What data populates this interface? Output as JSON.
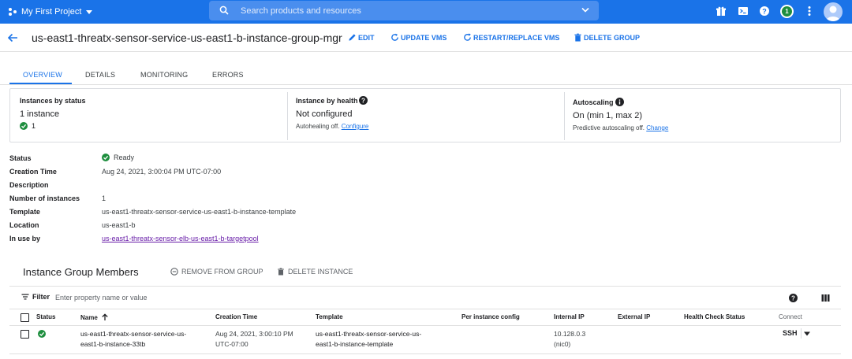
{
  "topbar": {
    "project": "My First Project",
    "search_placeholder": "Search products and resources",
    "notification_count": "1"
  },
  "header": {
    "title": "us-east1-threatx-sensor-service-us-east1-b-instance-group-mgr",
    "actions": {
      "edit": "EDIT",
      "update": "UPDATE VMS",
      "restart": "RESTART/REPLACE VMS",
      "delete": "DELETE GROUP"
    }
  },
  "tabs": [
    "OVERVIEW",
    "DETAILS",
    "MONITORING",
    "ERRORS"
  ],
  "summary": {
    "status": {
      "title": "Instances by status",
      "value": "1 instance",
      "ok_count": "1"
    },
    "health": {
      "title": "Instance by health",
      "value": "Not configured",
      "sub": "Autohealing off.",
      "link": "Configure"
    },
    "autoscaling": {
      "title": "Autoscaling",
      "value": "On (min 1, max 2)",
      "sub": "Predictive autoscaling off.",
      "link": "Change"
    }
  },
  "details": {
    "status_label": "Status",
    "status_value": "Ready",
    "creation_label": "Creation Time",
    "creation_value": "Aug 24, 2021, 3:00:04 PM UTC-07:00",
    "description_label": "Description",
    "instances_label": "Number of instances",
    "instances_value": "1",
    "template_label": "Template",
    "template_value": "us-east1-threatx-sensor-service-us-east1-b-instance-template",
    "location_label": "Location",
    "location_value": "us-east1-b",
    "inuse_label": "In use by",
    "inuse_value": "us-east1-threatx-sensor-elb-us-east1-b-targetpool"
  },
  "members": {
    "title": "Instance Group Members",
    "remove": "REMOVE FROM GROUP",
    "delete": "DELETE INSTANCE",
    "filter_label": "Filter",
    "filter_placeholder": "Enter property name or value",
    "columns": {
      "status": "Status",
      "name": "Name",
      "creation": "Creation Time",
      "template": "Template",
      "per_instance": "Per instance config",
      "internal_ip": "Internal IP",
      "external_ip": "External IP",
      "health": "Health Check Status",
      "connect": "Connect"
    },
    "row": {
      "name_1": "us-east1-threatx-sensor-service-us-",
      "name_2": "east1-b-instance-33tb",
      "creation_1": "Aug 24, 2021, 3:00:10 PM",
      "creation_2": "UTC-07:00",
      "template_1": "us-east1-threatx-sensor-service-us-",
      "template_2": "east1-b-instance-template",
      "ip_1": "10.128.0.3",
      "ip_2": "(nic0)",
      "connect": "SSH"
    }
  },
  "colors": {
    "brand": "#1a73e8",
    "ok": "#1e8e3e",
    "visited_link": "#681da8"
  }
}
